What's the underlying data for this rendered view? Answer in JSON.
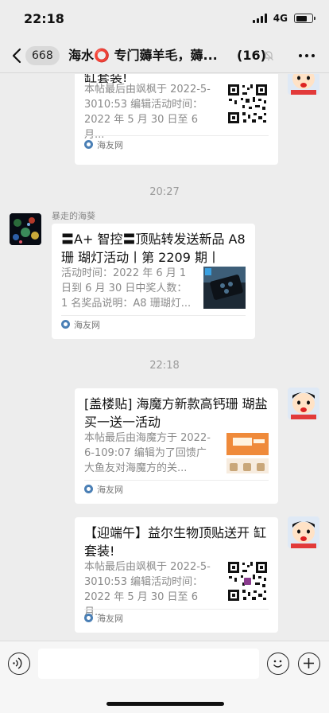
{
  "status_bar": {
    "time": "22:18",
    "network": "4G",
    "battery_level": 0.7
  },
  "nav": {
    "back_badge": "668",
    "title": "海水⭕ 专门薅羊毛，薅...",
    "member_count": "(16)"
  },
  "messages": [
    {
      "side": "right",
      "title": "缸套装!",
      "desc": "本帖最后由飒枫于 2022-5-3010:53 编辑活动时间：2022 年 5 月 30 日至 6 月...",
      "site": "海友网",
      "thumb": "qr-code"
    },
    {
      "time": "20:27"
    },
    {
      "side": "left",
      "sender": "暴走的海葵",
      "title": "〓A+ 智控〓顶贴转发送新品 A8 珊 瑚灯活动丨第 2209 期丨",
      "desc": "活动时间：2022 年 6 月 1 日到 6 月 30 日中奖人数：1 名奖品说明：A8 珊瑚灯...",
      "site": "海友网",
      "thumb": "product-photo"
    },
    {
      "time": "22:18"
    },
    {
      "side": "right",
      "title": "[盖楼贴] 海魔方新款高钙珊 瑚盐买一送一活动",
      "desc": "本帖最后由海魔方于 2022-6-109:07 编辑为了回馈广大鱼友对海魔方的关...",
      "site": "海友网",
      "thumb": "promo-banner"
    },
    {
      "side": "right",
      "title": "【迎端午】益尔生物顶贴送开 缸套装!",
      "desc": "本帖最后由飒枫于 2022-5-3010:53 编辑活动时间：2022 年 5 月 30 日至 6 月...",
      "site": "海友网",
      "thumb": "qr-code"
    }
  ],
  "input": {
    "placeholder": ""
  },
  "colors": {
    "background": "#ededed",
    "card": "#ffffff",
    "secondary_text": "#8a8a8a"
  }
}
